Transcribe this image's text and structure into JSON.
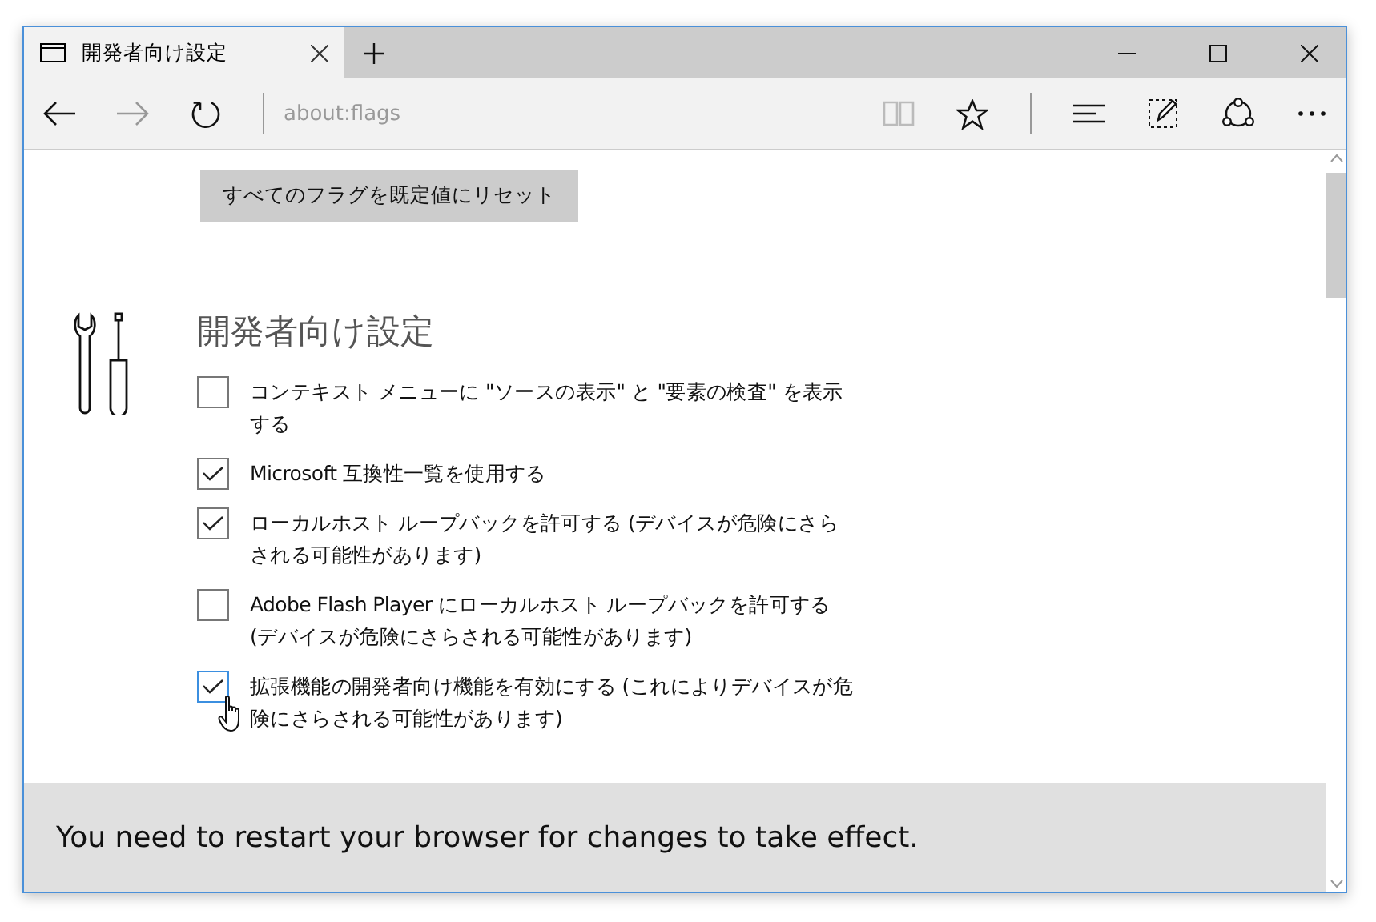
{
  "window": {
    "tab": {
      "title": "開発者向け設定",
      "selected": true
    }
  },
  "toolbar": {
    "address": "about:flags"
  },
  "reset_button": "すべてのフラグを既定値にリセット",
  "section": {
    "title": "開発者向け設定",
    "options": [
      {
        "label": "コンテキスト メニューに \"ソースの表示\" と \"要素の検査\" を表示する",
        "checked": false,
        "focused": false
      },
      {
        "label": "Microsoft 互換性一覧を使用する",
        "checked": true,
        "focused": false
      },
      {
        "label": "ローカルホスト ループバックを許可する (デバイスが危険にさらされる可能性があります)",
        "checked": true,
        "focused": false
      },
      {
        "label": "Adobe Flash Player にローカルホスト ループバックを許可する (デバイスが危険にさらされる可能性があります)",
        "checked": false,
        "focused": false
      },
      {
        "label": "拡張機能の開発者向け機能を有効にする (これによりデバイスが危険にさらされる可能性があります)",
        "checked": true,
        "focused": true
      }
    ]
  },
  "notice": "You need to restart your browser for changes to take effect."
}
